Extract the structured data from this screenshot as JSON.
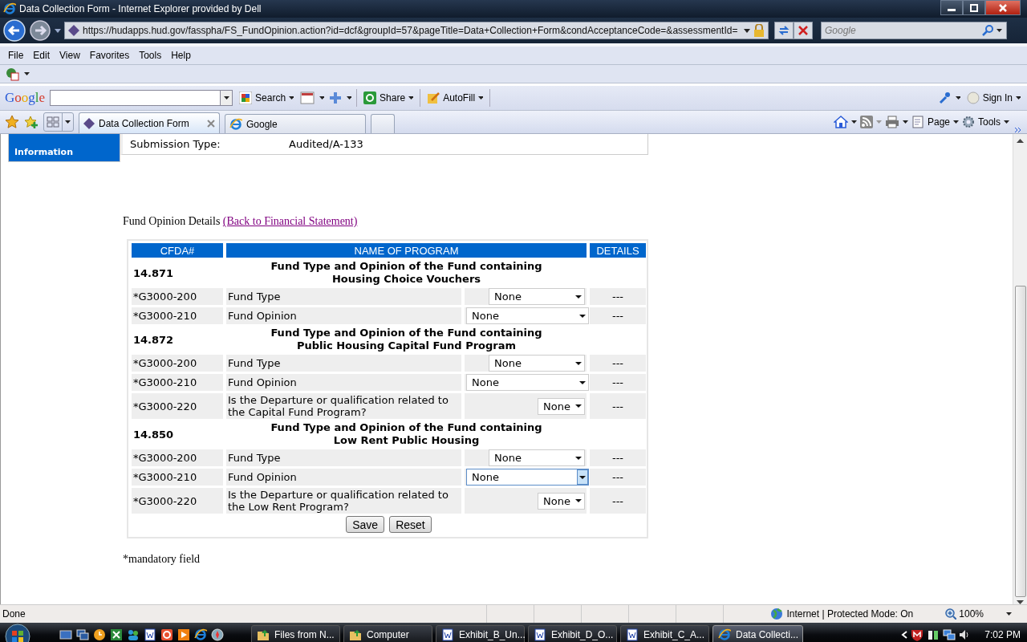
{
  "window": {
    "title": "Data Collection Form - Internet Explorer provided by Dell"
  },
  "address_bar": {
    "url": "https://hudapps.hud.gov/fasspha/FS_FundOpinion.action?id=dcf&groupId=57&pageTitle=Data+Collection+Form&condAcceptanceCode=&assessmentId=",
    "search_placeholder": "Google"
  },
  "menu": [
    "File",
    "Edit",
    "View",
    "Favorites",
    "Tools",
    "Help"
  ],
  "google_toolbar": {
    "logo": "Google",
    "buttons": [
      {
        "label": "Search",
        "kind": "search"
      },
      {
        "label": "Share",
        "kind": "share"
      },
      {
        "label": "AutoFill",
        "kind": "autofill"
      }
    ],
    "sign_in": "Sign In"
  },
  "tabs": [
    {
      "label": "Data Collection Form",
      "selected": true
    },
    {
      "label": "Google",
      "selected": false
    }
  ],
  "command_bar": [
    {
      "label": "Page",
      "kind": "page"
    },
    {
      "label": "Tools",
      "kind": "tools"
    }
  ],
  "sidebar": {
    "item": "Information",
    "selected": true
  },
  "submission": {
    "label": "Submission Type:",
    "value": "Audited/A-133"
  },
  "heading": {
    "text": "Fund Opinion Details",
    "link": "(Back to Financial Statement)"
  },
  "table": {
    "columns": [
      "CFDA#",
      "NAME OF PROGRAM",
      "DETAILS"
    ],
    "sections": [
      {
        "cfda": "14.871",
        "title_lines": [
          "Fund Type and Opinion of the Fund containing",
          "Housing Choice Vouchers"
        ],
        "rows": [
          {
            "code": "*G3000-200",
            "label": "Fund Type",
            "kind": "type",
            "value": "None",
            "focused": false,
            "details": "---"
          },
          {
            "code": "*G3000-210",
            "label": "Fund Opinion",
            "kind": "opinion",
            "value": "None",
            "focused": false,
            "details": "---"
          }
        ]
      },
      {
        "cfda": "14.872",
        "title_lines": [
          "Fund Type and Opinion of the Fund containing",
          "Public Housing Capital Fund Program"
        ],
        "rows": [
          {
            "code": "*G3000-200",
            "label": "Fund Type",
            "kind": "type",
            "value": "None",
            "focused": false,
            "details": "---"
          },
          {
            "code": "*G3000-210",
            "label": "Fund Opinion",
            "kind": "opinion",
            "value": "None",
            "focused": false,
            "details": "---"
          },
          {
            "code": "*G3000-220",
            "label": "Is the Departure or qualification related to the Capital Fund Program?",
            "kind": "question",
            "value": "None",
            "focused": false,
            "details": "---"
          }
        ]
      },
      {
        "cfda": "14.850",
        "title_lines": [
          "Fund Type and Opinion of the Fund containing",
          "Low Rent Public Housing"
        ],
        "rows": [
          {
            "code": "*G3000-200",
            "label": "Fund Type",
            "kind": "type",
            "value": "None",
            "focused": false,
            "details": "---"
          },
          {
            "code": "*G3000-210",
            "label": "Fund Opinion",
            "kind": "opinion",
            "value": "None",
            "focused": true,
            "details": "---"
          },
          {
            "code": "*G3000-220",
            "label": "Is the Departure or qualification related to the Low Rent Program?",
            "kind": "question",
            "value": "None",
            "focused": false,
            "details": "---"
          }
        ]
      }
    ]
  },
  "buttons": [
    "Save",
    "Reset"
  ],
  "footnote": "*mandatory field",
  "status_bar": {
    "text": "Done",
    "zone": "Internet | Protected Mode: On",
    "zoom": "100%"
  },
  "taskbar": {
    "windows": [
      {
        "label": "Files from N...",
        "kind": "folder",
        "selected": false
      },
      {
        "label": "Computer",
        "kind": "folder",
        "selected": false
      },
      {
        "label": "Exhibit_B_Un...",
        "kind": "word",
        "selected": false
      },
      {
        "label": "Exhibit_D_O...",
        "kind": "word",
        "selected": false
      },
      {
        "label": "Exhibit_C_A...",
        "kind": "word",
        "selected": false
      },
      {
        "label": "Data Collecti...",
        "kind": "ie",
        "selected": true
      }
    ],
    "clock": "7:02 PM"
  }
}
